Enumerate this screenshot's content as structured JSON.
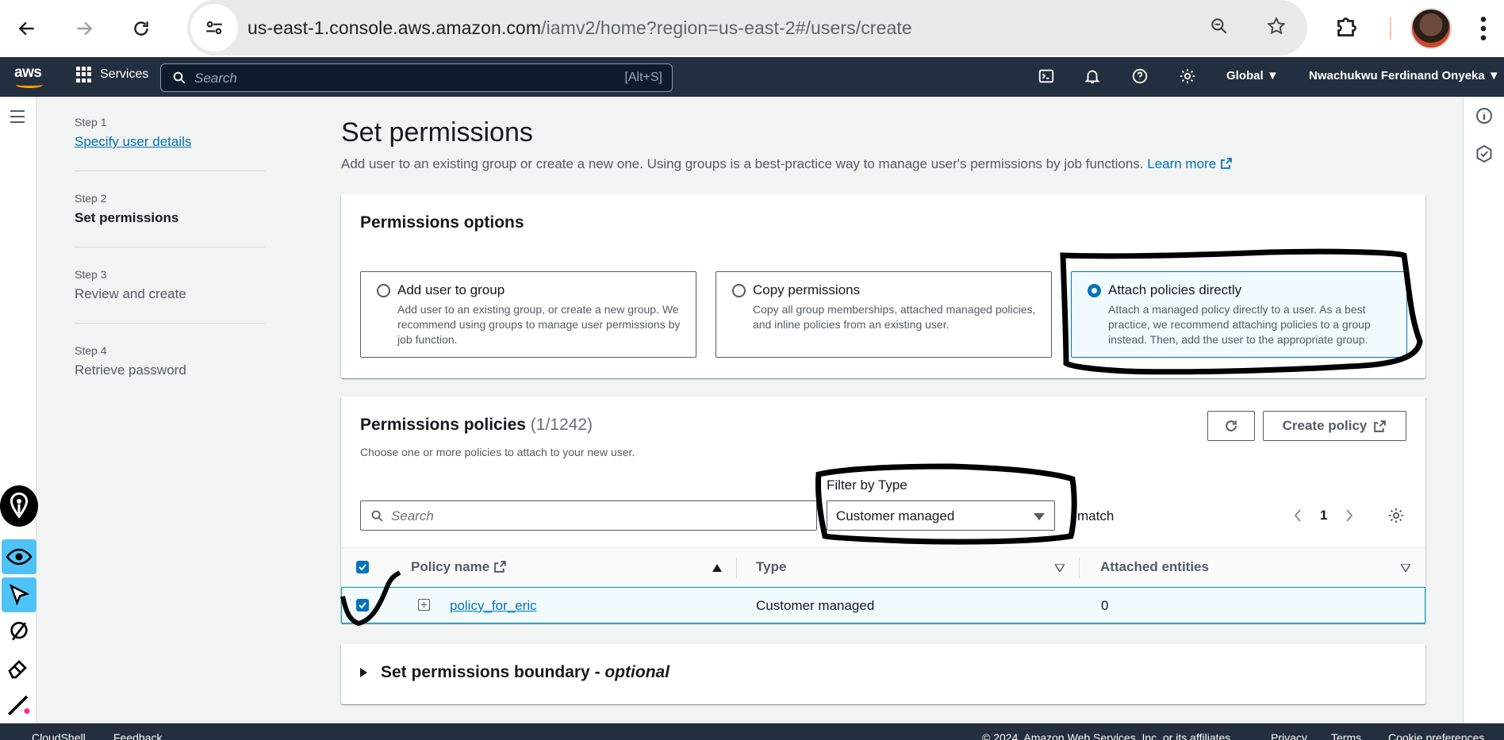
{
  "browser": {
    "url_host": "us-east-1.console.aws.amazon.com",
    "url_path": "/iamv2/home?region=us-east-2#/users/create"
  },
  "aws_nav": {
    "services_label": "Services",
    "search_placeholder": "Search",
    "search_shortcut": "[Alt+S]",
    "region": "Global ▼",
    "account": "Nwachukwu Ferdinand Onyeka ▼"
  },
  "steps": [
    {
      "num": "Step 1",
      "title": "Specify user details"
    },
    {
      "num": "Step 2",
      "title": "Set permissions"
    },
    {
      "num": "Step 3",
      "title": "Review and create"
    },
    {
      "num": "Step 4",
      "title": "Retrieve password"
    }
  ],
  "page": {
    "title": "Set permissions",
    "description": "Add user to an existing group or create a new one. Using groups is a best-practice way to manage user's permissions by job functions.",
    "learn_more": "Learn more"
  },
  "permissions_options": {
    "heading": "Permissions options",
    "options": [
      {
        "title": "Add user to group",
        "desc": "Add user to an existing group, or create a new group. We recommend using groups to manage user permissions by job function.",
        "selected": false
      },
      {
        "title": "Copy permissions",
        "desc": "Copy all group memberships, attached managed policies, and inline policies from an existing user.",
        "selected": false
      },
      {
        "title": "Attach policies directly",
        "desc": "Attach a managed policy directly to a user. As a best practice, we recommend attaching policies to a group instead. Then, add the user to the appropriate group.",
        "selected": true
      }
    ]
  },
  "policies": {
    "heading": "Permissions policies",
    "count": "(1/1242)",
    "subtitle": "Choose one or more policies to attach to your new user.",
    "create_policy": "Create policy",
    "filter_label": "Filter by Type",
    "search_placeholder": "Search",
    "filter_value": "Customer managed",
    "match": "match",
    "page": "1",
    "columns": {
      "name": "Policy name",
      "type": "Type",
      "entities": "Attached entities"
    },
    "rows": [
      {
        "name": "policy_for_eric",
        "type": "Customer managed",
        "entities": "0",
        "checked": true
      }
    ]
  },
  "boundary": {
    "title": "Set permissions boundary - ",
    "optional": "optional"
  },
  "footer": {
    "cloudshell": "CloudShell",
    "feedback": "Feedback",
    "copyright": "© 2024, Amazon Web Services, Inc. or its affiliates.",
    "privacy": "Privacy",
    "terms": "Terms",
    "cookies": "Cookie preferences"
  },
  "colors": {
    "aws_nav": "#232f3e",
    "link": "#0073bb",
    "accent": "#ff9900"
  }
}
